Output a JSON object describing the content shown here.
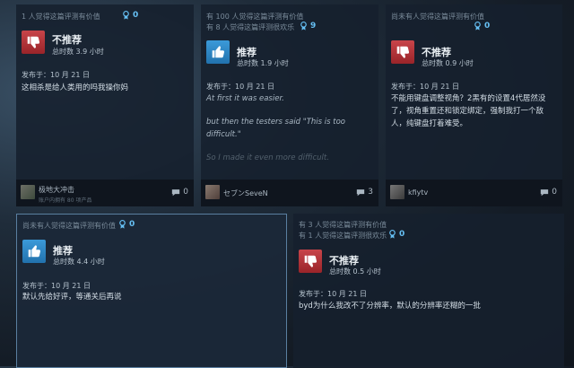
{
  "reviews": [
    {
      "helpful": [
        "1 人觉得这篇评测有价值"
      ],
      "awards": "0",
      "recommended": false,
      "verdict": "不推荐",
      "hours": "总时数 3.9 小时",
      "posted": "发布于：10 月 21 日",
      "body": [
        "这相杀是给人类用的吗我操你妈"
      ],
      "user": "极地大冲击",
      "user_sub": "账户内拥有 80 项产品",
      "comments": "0"
    },
    {
      "helpful": [
        "有 100 人觉得这篇评测有价值",
        "有 8 人觉得这篇评测很欢乐"
      ],
      "awards": "9",
      "recommended": true,
      "verdict": "推荐",
      "hours": "总时数 1.9 小时",
      "posted": "发布于：10 月 21 日",
      "body": [
        "At first it was easier.",
        "but then the testers said \"This is too difficult.\"",
        "So I made it even more difficult."
      ],
      "user": "セブンSeveN",
      "comments": "3"
    },
    {
      "helpful": [
        "尚未有人觉得这篇评测有价值"
      ],
      "awards": "0",
      "recommended": false,
      "verdict": "不推荐",
      "hours": "总时数 0.9 小时",
      "posted": "发布于：10 月 21 日",
      "body": [
        "不能用键盘调整视角？2黑有的设置4代居然没了，视角重置还和锁定绑定，强制我打一个敌人，纯键盘打着难受。"
      ],
      "user": "kfiytv",
      "comments": "0"
    },
    {
      "helpful": [
        "尚未有人觉得这篇评测有价值"
      ],
      "awards": "0",
      "recommended": true,
      "verdict": "推荐",
      "hours": "总时数 4.4 小时",
      "posted": "发布于：10 月 21 日",
      "body": [
        "默认先给好评，等通关后再说"
      ]
    },
    {
      "helpful": [
        "有 3 人觉得这篇评测有价值",
        "有 1 人觉得这篇评测很欢乐"
      ],
      "awards": "0",
      "recommended": false,
      "verdict": "不推荐",
      "hours": "总时数 0.5 小时",
      "posted": "发布于：10 月 21 日",
      "body": [
        "byd为什么我改不了分辨率，默认的分辨率还糊的一批"
      ]
    }
  ],
  "colors": {
    "down": "#b83a3f",
    "up": "#2f86c6",
    "award": "#66c0f4"
  }
}
